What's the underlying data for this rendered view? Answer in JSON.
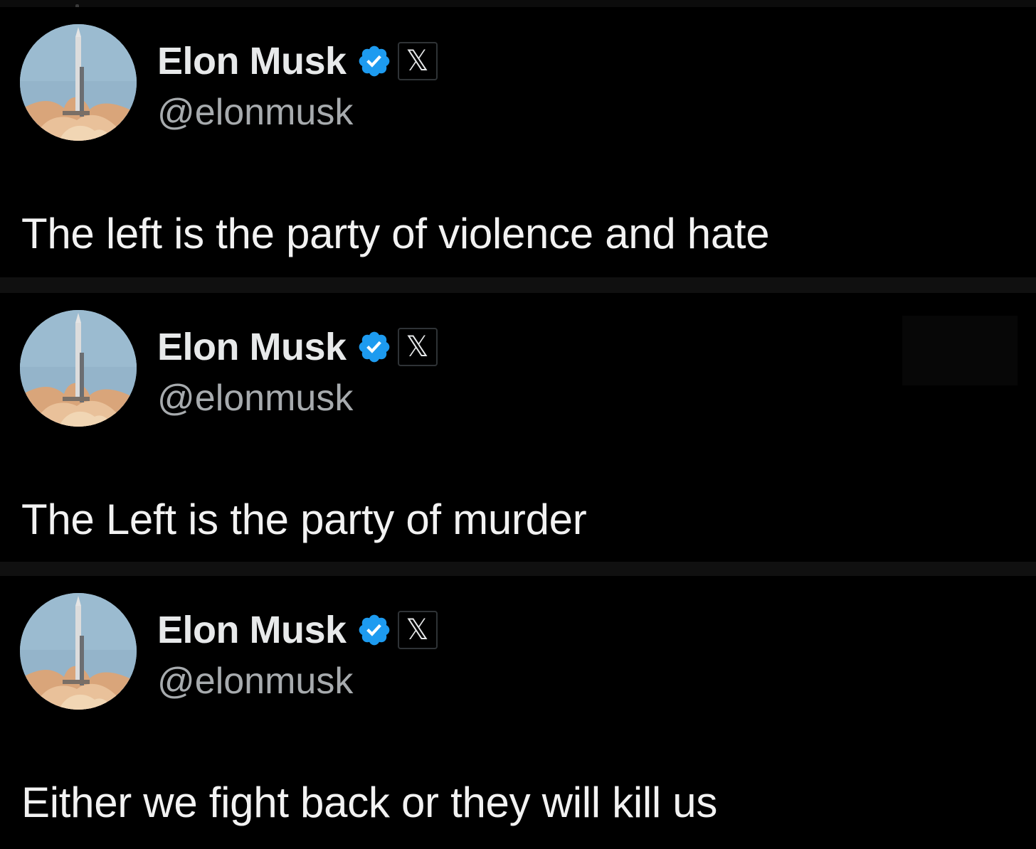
{
  "posts": [
    {
      "author": {
        "name": "Elon Musk",
        "handle": "@elonmusk",
        "verified_icon": "verified-badge-icon",
        "affiliation_badge": "𝕏"
      },
      "text": "The left is the party of violence and hate"
    },
    {
      "author": {
        "name": "Elon Musk",
        "handle": "@elonmusk",
        "verified_icon": "verified-badge-icon",
        "affiliation_badge": "𝕏"
      },
      "text": "The Left is the party of murder"
    },
    {
      "author": {
        "name": "Elon Musk",
        "handle": "@elonmusk",
        "verified_icon": "verified-badge-icon",
        "affiliation_badge": "𝕏"
      },
      "text": "Either we fight back or they will kill us"
    }
  ],
  "colors": {
    "background": "#000000",
    "name_text": "#e7e9ea",
    "handle_text": "#a7abae",
    "verified_blue": "#1d9bf0",
    "divider": "#101010"
  }
}
